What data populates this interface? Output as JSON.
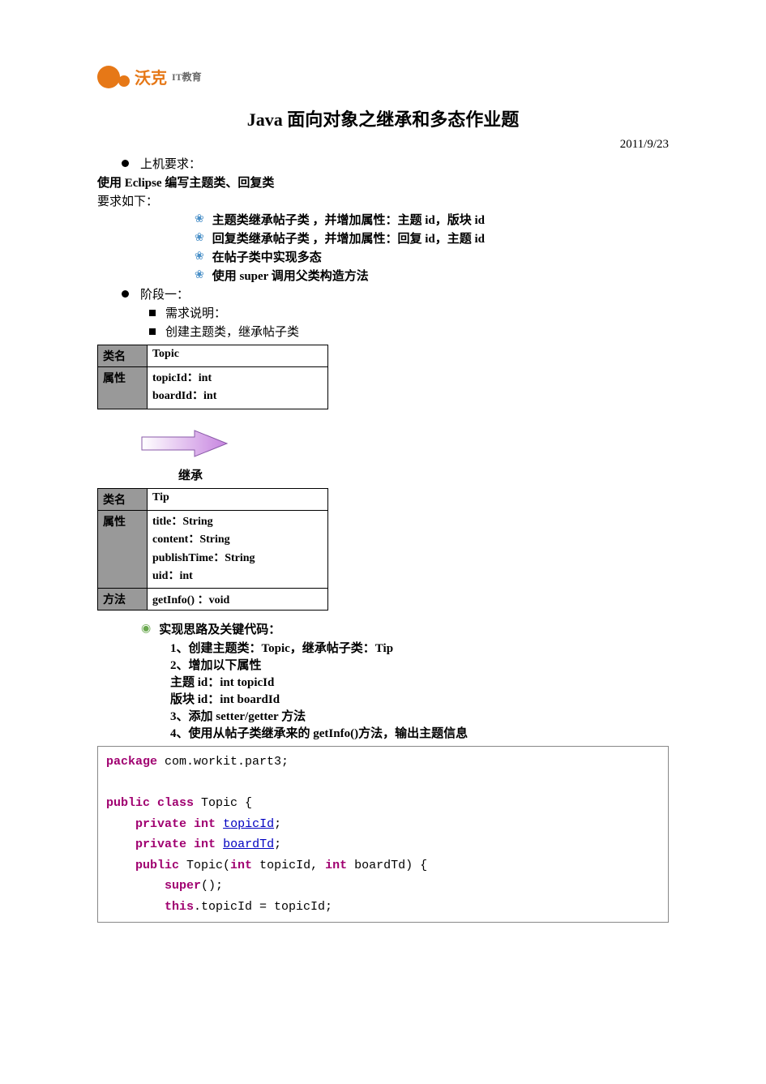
{
  "logo": {
    "main": "沃克",
    "sub": "IT教育"
  },
  "title": "Java 面向对象之继承和多态作业题",
  "date": "2011/9/23",
  "h1": "上机要求：",
  "line1": "使用 Eclipse 编写主题类、回复类",
  "line2": "要求如下：",
  "reqs": [
    "主题类继承帖子类 ，并增加属性：主题 id，版块 id",
    "回复类继承帖子类 ，并增加属性：回复 id，主题 id",
    "在帖子类中实现多态",
    "使用 super 调用父类构造方法"
  ],
  "h2": "阶段一：",
  "phase_a": "需求说明：",
  "phase_b": "创建主题类，继承帖子类",
  "table1": {
    "r1c1": "类名",
    "r1c2": "Topic",
    "r2c1": "属性",
    "r2c2": "topicId：int\nboardId：int"
  },
  "inherit": "继承",
  "table2": {
    "r1c1": "类名",
    "r1c2": "Tip",
    "r2c1": "属性",
    "r2c2": "title：String\ncontent：String\npublishTime：String\nuid：int",
    "r3c1": "方法",
    "r3c2": "getInfo()  ：void"
  },
  "impl_h": "实现思路及关键代码：",
  "impl": [
    "1、创建主题类：Topic，继承帖子类：Tip",
    "2、增加以下属性",
    "主题 id：int topicId",
    "版块 id：int boardId",
    "3、添加 setter/getter 方法",
    "4、使用从帖子类继承来的 getInfo()方法，输出主题信息"
  ],
  "code": {
    "pkg_kw": "package",
    "pkg": " com.workit.part3;",
    "pub": "public",
    "cls": "class",
    "clsname": " Topic {",
    "priv": "private",
    "int_kw": "int",
    "f1": "topicId",
    "f2": "boardTd",
    "ctor": " Topic(",
    "args": "int topicId, int boardTd) {",
    "super_kw": "super",
    "super_rest": "();",
    "this_kw": "this",
    "assign": ".topicId = topicId;"
  }
}
